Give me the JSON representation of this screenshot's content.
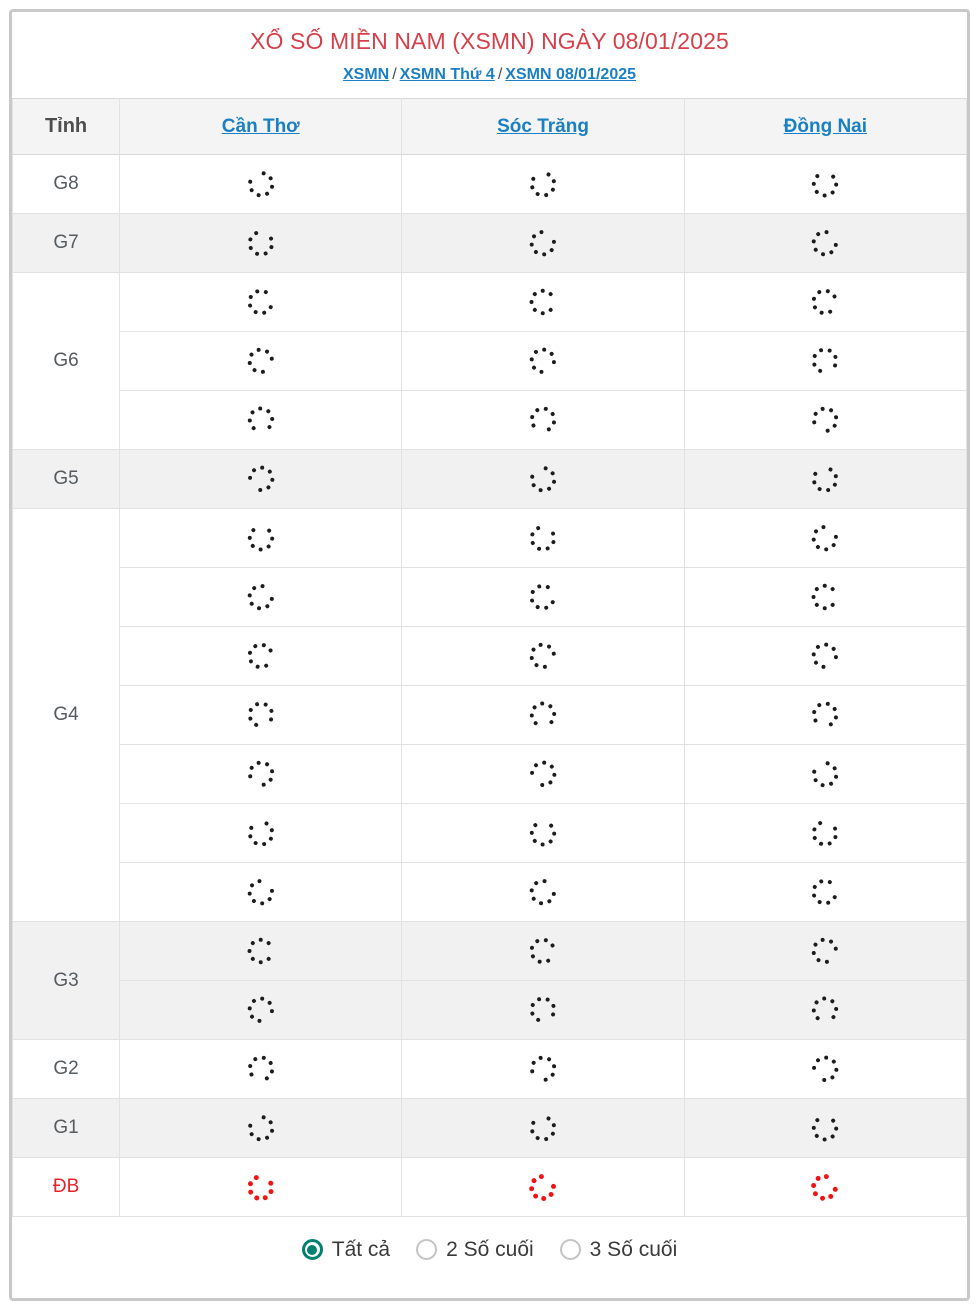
{
  "header": {
    "title": "XỔ SỐ MIỀN NAM (XSMN) NGÀY 08/01/2025",
    "title_color": "#d6404a",
    "breadcrumb": [
      {
        "label": "XSMN"
      },
      {
        "label": "XSMN Thứ 4"
      },
      {
        "label": "XSMN 08/01/2025"
      }
    ],
    "breadcrumb_separator": "/"
  },
  "table": {
    "columns": [
      {
        "label": "Tỉnh",
        "kind": "row-header"
      },
      {
        "label": "Cần Thơ",
        "kind": "province"
      },
      {
        "label": "Sóc Trăng",
        "kind": "province"
      },
      {
        "label": "Đồng Nai",
        "kind": "province"
      }
    ],
    "prize_rows": [
      {
        "label": "G8",
        "span": 1,
        "shaded": false,
        "cells_status": "loading"
      },
      {
        "label": "G7",
        "span": 1,
        "shaded": true,
        "cells_status": "loading"
      },
      {
        "label": "G6",
        "span": 3,
        "shaded": false,
        "cells_status": "loading"
      },
      {
        "label": "G5",
        "span": 1,
        "shaded": true,
        "cells_status": "loading"
      },
      {
        "label": "G4",
        "span": 7,
        "shaded": false,
        "cells_status": "loading"
      },
      {
        "label": "G3",
        "span": 2,
        "shaded": true,
        "cells_status": "loading"
      },
      {
        "label": "G2",
        "span": 1,
        "shaded": false,
        "cells_status": "loading"
      },
      {
        "label": "G1",
        "span": 1,
        "shaded": true,
        "cells_status": "loading"
      },
      {
        "label": "ĐB",
        "span": 1,
        "shaded": false,
        "cells_status": "loading",
        "highlight_color": "#e8232a"
      }
    ],
    "loading_indicator": "spinner-icon",
    "spinner_color": "#1c1c1c",
    "spinner_color_special": "#f01414"
  },
  "footer": {
    "filter_options": [
      {
        "label": "Tất cả",
        "selected": true
      },
      {
        "label": "2 Số cuối",
        "selected": false
      },
      {
        "label": "3 Số cuối",
        "selected": false
      }
    ],
    "selected_color": "#00806f"
  }
}
